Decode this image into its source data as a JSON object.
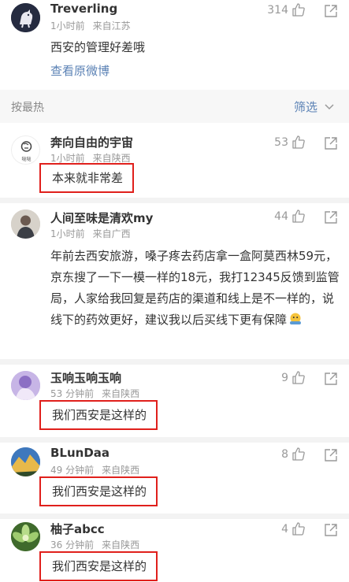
{
  "top_post": {
    "name": "Treverling",
    "time": "1小时前",
    "location": "来自江苏",
    "text": "西安的管理好差哦",
    "likes": "314",
    "view_original": "查看原微博"
  },
  "sort_bar": {
    "label": "按最热",
    "filter": "筛选"
  },
  "comments": [
    {
      "name": "奔向自由的宇宙",
      "time": "1小时前",
      "location": "来自陕西",
      "text": "本来就非常差",
      "likes": "53",
      "avatar_text": "哒哒"
    },
    {
      "name": "人间至味是清欢my",
      "time": "1小时前",
      "location": "来自广西",
      "text": "年前去西安旅游，嗓子疼去药店拿一盒阿莫西林59元，京东搜了一下一模一样的18元，我打12345反馈到监管局，人家给我回复是药店的渠道和线上是不一样的，说线下的药效更好，建议我以后买线下更有保障",
      "likes": "44"
    },
    {
      "name": "玉响玉响玉响",
      "time": "53 分钟前",
      "location": "来自陕西",
      "text": "我们西安是这样的",
      "likes": "9"
    },
    {
      "name": "BLunDaa",
      "time": "49 分钟前",
      "location": "来自陕西",
      "text": "我们西安是这样的",
      "likes": "8"
    },
    {
      "name": "柚子abcc",
      "time": "36 分钟前",
      "location": "来自陕西",
      "text": "我们西安是这样的",
      "likes": "4"
    }
  ],
  "colors": {
    "link": "#5b82b5",
    "highlight_box": "#e0201c"
  }
}
